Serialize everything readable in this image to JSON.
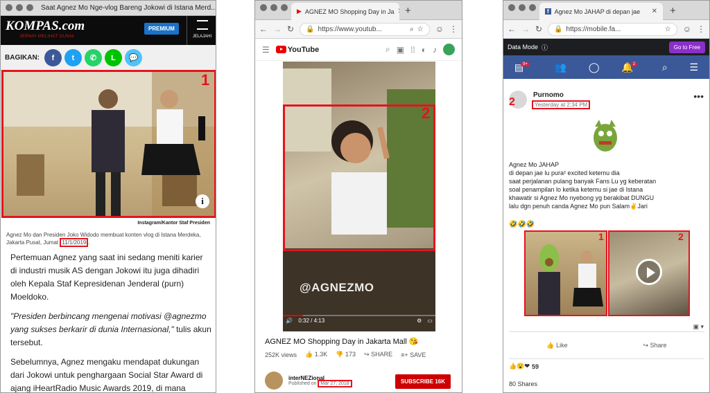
{
  "win1": {
    "title": "Saat Agnez Mo Nge-vlog Bareng Jokowi di Istana Merd...",
    "logo": "KOMPAS.com",
    "tagline": "JERNIH MELIHAT DUNIA",
    "premium": "PREMIUM",
    "jelajahi": "JELAJAHI",
    "bagikan": "BAGIKAN:",
    "marker": "1",
    "credit": "Instagram/Kantor Staf Presiden",
    "caption_prefix": "Agnez Mo dan Presiden Joko Widodo membuat konten vlog di Istana Merdeka, Jakarta Pusat, Jumat ",
    "caption_date": "11/1/2019",
    "caption_suffix": ".",
    "para1": "Pertemuan Agnez yang saat ini sedang meniti karier di industri musik AS dengan Jokowi itu juga dihadiri oleh Kepala Staf Kepresidenan Jenderal (purn) Moeldoko.",
    "para2_quote": "\"Presiden berbincang mengenai motivasi @agnezmo yang sukses berkarir di dunia Internasional,\"",
    "para2_tail": " tulis akun tersebut.",
    "para3": "Sebelumnya, Agnez mengaku mendapat dukungan dari Jokowi untuk penghargaan Social Star Award di ajang iHeartRadio Music Awards 2019, di mana",
    "colors": {
      "kompas_red": "#c4221a",
      "premium_blue": "#1a73c9"
    }
  },
  "win2": {
    "tab_title": "AGNEZ MO Shopping Day in Ja",
    "url": "https://www.youtub...",
    "yt_logo": "YouTube",
    "marker": "2",
    "watermark": "@AGNEZMO",
    "time": "0:32 / 4:13",
    "progress": 0.13,
    "video_title": "AGNEZ MO Shopping Day in Jakarta Mall 😘",
    "views": "252K views",
    "likes": "1.3K",
    "dislikes": "173",
    "share": "SHARE",
    "save": "SAVE",
    "channel": "interNEZional",
    "published_prefix": "Published on ",
    "published_date": "Mar 27, 2018",
    "subscribe": "SUBSCRIBE",
    "subs": "16K"
  },
  "win3": {
    "tab_title": "Agnez Mo JAHAP di depan jae",
    "url": "https://mobile.fa...",
    "data_mode": "Data Mode",
    "go_free": "Go to Free",
    "notif_badge": "9+",
    "alert_badge": "2",
    "author": "Purnomo",
    "marker": "2",
    "time": "Yesterday at 2:34 PM",
    "post_lines": [
      "Agnez Mo JAHAP",
      "di depan jae lu pura² excited ketemu dia",
      "saat perjalanan pulang banyak Fans Lu yg keberatan",
      "soal penampilan lo ketika ketemu si jae di Istana",
      "khawatir si Agnez Mo nyebong yg berakibat DUNGU",
      "lalu dgn penuh canda Agnez Mo pun Salam✌Jari"
    ],
    "emojis": "🤣🤣🤣",
    "thumb1_marker": "1",
    "thumb2_marker": "2",
    "like": "Like",
    "share": "Share",
    "reaction_count": "59",
    "shares": "80 Shares"
  }
}
